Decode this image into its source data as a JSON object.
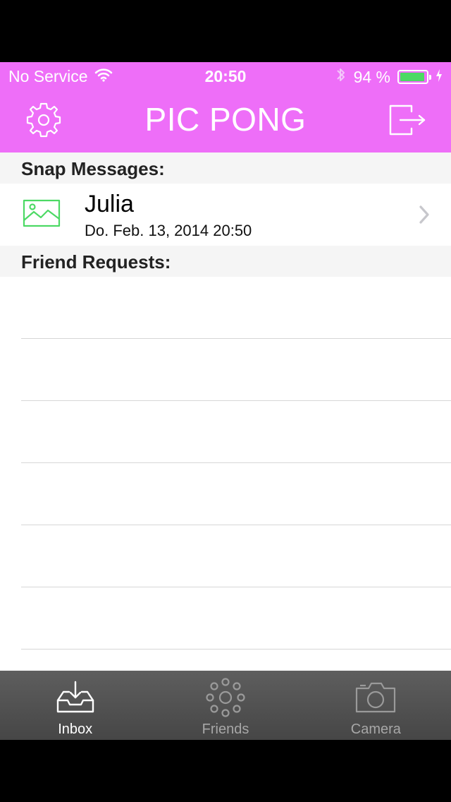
{
  "status_bar": {
    "carrier": "No Service",
    "time": "20:50",
    "battery_percent": "94 %",
    "battery_level": 0.94
  },
  "nav": {
    "title": "PIC PONG",
    "settings_icon": "gear-icon",
    "logout_icon": "logout-icon"
  },
  "sections": {
    "snap_messages": "Snap Messages:",
    "friend_requests": "Friend Requests:"
  },
  "messages": [
    {
      "name": "Julia",
      "date": "Do. Feb. 13, 2014 20:50",
      "icon": "image-icon"
    }
  ],
  "tabs": [
    {
      "label": "Inbox",
      "icon": "inbox-icon",
      "active": true
    },
    {
      "label": "Friends",
      "icon": "friends-icon",
      "active": false
    },
    {
      "label": "Camera",
      "icon": "camera-icon",
      "active": false
    }
  ],
  "colors": {
    "accent": "#ee6ef8",
    "battery": "#4cd964",
    "image_icon": "#4cd964"
  }
}
